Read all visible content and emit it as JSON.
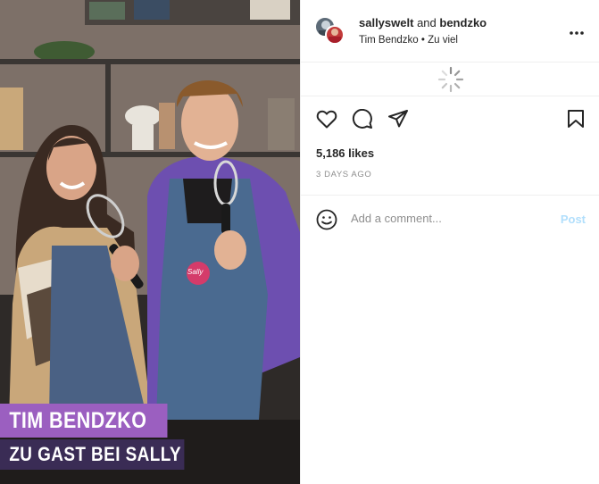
{
  "media": {
    "caption_line1": "TIM BENDZKO",
    "caption_line2": "ZU GAST BEI SALLY",
    "apron_logo": "Sally"
  },
  "header": {
    "user1": "sallyswelt",
    "and_text": "and",
    "user2": "bendzko",
    "subtitle": "Tim Bendzko • Zu viel",
    "more_label": "..."
  },
  "actions": {
    "icons": [
      "heart-icon",
      "comment-icon",
      "share-icon",
      "bookmark-icon"
    ]
  },
  "stats": {
    "likes": "5,186 likes",
    "time_ago": "3 DAYS AGO"
  },
  "comment": {
    "placeholder": "Add a comment...",
    "post_label": "Post"
  },
  "colors": {
    "caption_purple": "#9b5fc0",
    "caption_dark": "#3a2c55",
    "post_disabled": "#b2dffc",
    "muted": "#8e8e8e"
  }
}
